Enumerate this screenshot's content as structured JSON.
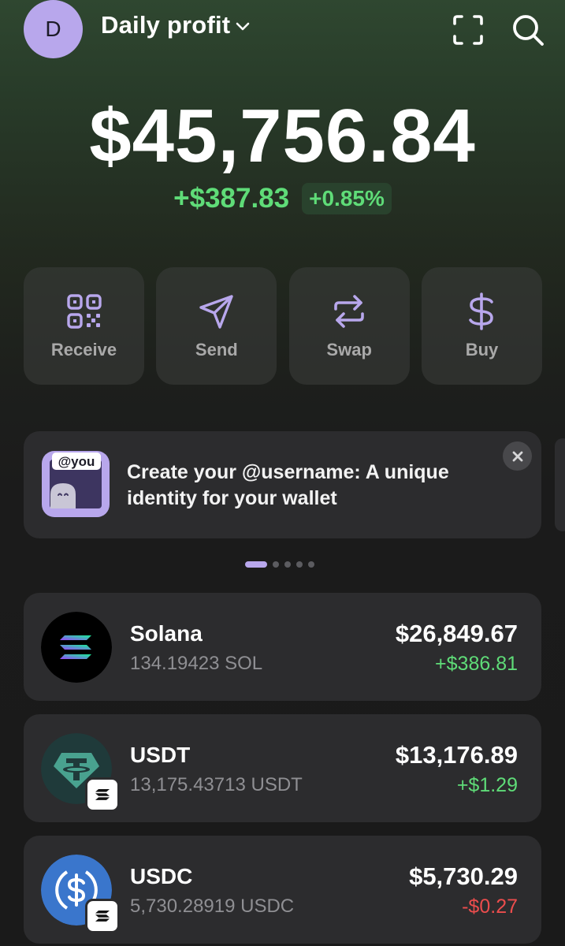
{
  "header": {
    "avatar_initial": "D",
    "profile_name": "Daily profit"
  },
  "balance": {
    "total": "$45,756.84",
    "change_amount": "+$387.83",
    "change_percent": "+0.85%"
  },
  "actions": [
    {
      "label": "Receive",
      "icon": "qr-code-icon"
    },
    {
      "label": "Send",
      "icon": "send-icon"
    },
    {
      "label": "Swap",
      "icon": "swap-icon"
    },
    {
      "label": "Buy",
      "icon": "dollar-icon"
    }
  ],
  "promo": {
    "image_label": "@you",
    "text": "Create your @username: A unique identity for your wallet"
  },
  "pager": {
    "count": 5,
    "active_index": 0
  },
  "tokens": [
    {
      "name": "Solana",
      "quantity": "134.19423 SOL",
      "value": "$26,849.67",
      "change": "+$386.81",
      "change_sign": "positive"
    },
    {
      "name": "USDT",
      "quantity": "13,175.43713 USDT",
      "value": "$13,176.89",
      "change": "+$1.29",
      "change_sign": "positive"
    },
    {
      "name": "USDC",
      "quantity": "5,730.28919 USDC",
      "value": "$5,730.29",
      "change": "-$0.27",
      "change_sign": "negative"
    }
  ],
  "colors": {
    "accent": "#b8a7ec",
    "positive": "#5fdc78",
    "negative": "#ec4d4d",
    "tether": "#49a28f",
    "usdc": "#3a76cc"
  }
}
